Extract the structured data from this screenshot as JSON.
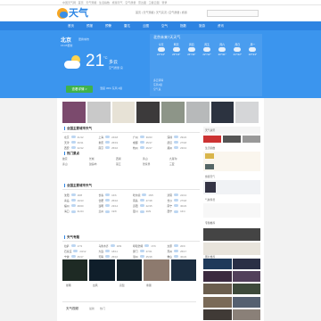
{
  "topbar": {
    "text": "中国天气网 · 首页 · 天气预报 · 生活指数 · 旅游天气 · 空气质量 · 雷达图 · 卫星云图 · 登录"
  },
  "header": {
    "logo_text": "天气",
    "links": "首页 | 天气预报 | 天气实况 | 空气质量 | 旅游",
    "search_placeholder": ""
  },
  "nav": {
    "items": [
      "首页",
      "预报",
      "预警",
      "雷达",
      "云图",
      "空气",
      "指数",
      "旅游",
      "资讯"
    ]
  },
  "hero": {
    "city": "北京",
    "city_sub": "更换城市",
    "city_small": "15:05更新",
    "temperature": "21",
    "degree": "°C",
    "condition": "多云",
    "aqi": "空气质量 良",
    "green_button": "查看详情 >",
    "mini": "湿度 45%  东风 2级"
  },
  "forecast": {
    "title": "北京未来7天天气",
    "days": [
      {
        "label": "今天",
        "temp": "21°/12°"
      },
      {
        "label": "明天",
        "temp": "23°/13°"
      },
      {
        "label": "周四",
        "temp": "24°/14°"
      },
      {
        "label": "周五",
        "temp": "22°/12°"
      },
      {
        "label": "周六",
        "temp": "20°/11°"
      },
      {
        "label": "周日",
        "temp": "21°/12°"
      },
      {
        "label": "周一",
        "temp": "23°/13°"
      }
    ],
    "trend_rows": [
      "多云转晴",
      "东风2级",
      "空气良"
    ]
  },
  "sections": {
    "cities_title": "全国主要城市天气",
    "hot_title": "热门景点",
    "travel_title": "全国主要城市天气",
    "feature_title": "天气专题",
    "bottom_title": "天气视频"
  },
  "cities": [
    {
      "name": "北京",
      "temp": "21/12"
    },
    {
      "name": "上海",
      "temp": "24/18"
    },
    {
      "name": "广州",
      "temp": "30/23"
    },
    {
      "name": "深圳",
      "temp": "29/24"
    },
    {
      "name": "天津",
      "temp": "20/11"
    },
    {
      "name": "重庆",
      "temp": "26/19"
    },
    {
      "name": "成都",
      "temp": "25/17"
    },
    {
      "name": "武汉",
      "temp": "27/18"
    },
    {
      "name": "西安",
      "temp": "22/12"
    },
    {
      "name": "南京",
      "temp": "25/16"
    },
    {
      "name": "杭州",
      "temp": "26/17"
    },
    {
      "name": "郑州",
      "temp": "23/13"
    }
  ],
  "hot_spots": [
    "故宫",
    "长城",
    "西湖",
    "黄山",
    "九寨沟",
    "泰山",
    "鼓浪屿",
    "丽江",
    "张家界",
    "三亚"
  ],
  "cities2": [
    {
      "name": "沈阳",
      "temp": "18/8"
    },
    {
      "name": "长春",
      "temp": "16/6"
    },
    {
      "name": "哈尔滨",
      "temp": "15/5"
    },
    {
      "name": "济南",
      "temp": "22/13"
    },
    {
      "name": "青岛",
      "temp": "19/13"
    },
    {
      "name": "合肥",
      "temp": "25/16"
    },
    {
      "name": "南昌",
      "temp": "27/18"
    },
    {
      "name": "长沙",
      "temp": "27/18"
    },
    {
      "name": "福州",
      "temp": "28/20"
    },
    {
      "name": "昆明",
      "temp": "23/14"
    },
    {
      "name": "贵阳",
      "temp": "22/15"
    },
    {
      "name": "南宁",
      "temp": "30/23"
    },
    {
      "name": "海口",
      "temp": "31/24"
    },
    {
      "name": "兰州",
      "temp": "19/8"
    },
    {
      "name": "银川",
      "temp": "20/9"
    },
    {
      "name": "西宁",
      "temp": "16/4"
    }
  ],
  "cities3": [
    {
      "name": "拉萨",
      "temp": "17/3"
    },
    {
      "name": "乌鲁木齐",
      "temp": "18/9"
    },
    {
      "name": "呼和浩特",
      "temp": "17/6"
    },
    {
      "name": "太原",
      "temp": "20/9"
    },
    {
      "name": "石家庄",
      "temp": "23/12"
    },
    {
      "name": "大连",
      "temp": "18/11"
    },
    {
      "name": "厦门",
      "temp": "27/21"
    },
    {
      "name": "苏州",
      "temp": "25/17"
    },
    {
      "name": "宁波",
      "temp": "25/17"
    },
    {
      "name": "无锡",
      "temp": "25/16"
    },
    {
      "name": "温州",
      "temp": "25/18"
    },
    {
      "name": "佛山",
      "temp": "30/23"
    }
  ],
  "feature_labels": [
    "暴雨",
    "台风",
    "高温",
    "寒潮"
  ],
  "bottom_tabs": [
    "最新",
    "热门"
  ],
  "side_texts": [
    "天气资讯",
    "生活指数",
    "旅游天气",
    "气象科普",
    "专题推荐",
    "图片推荐"
  ],
  "colors": {
    "brand": "#2e84e2",
    "hero": "#3b95ee",
    "green": "#3fb24b",
    "logo_sun": "#f6a623"
  }
}
